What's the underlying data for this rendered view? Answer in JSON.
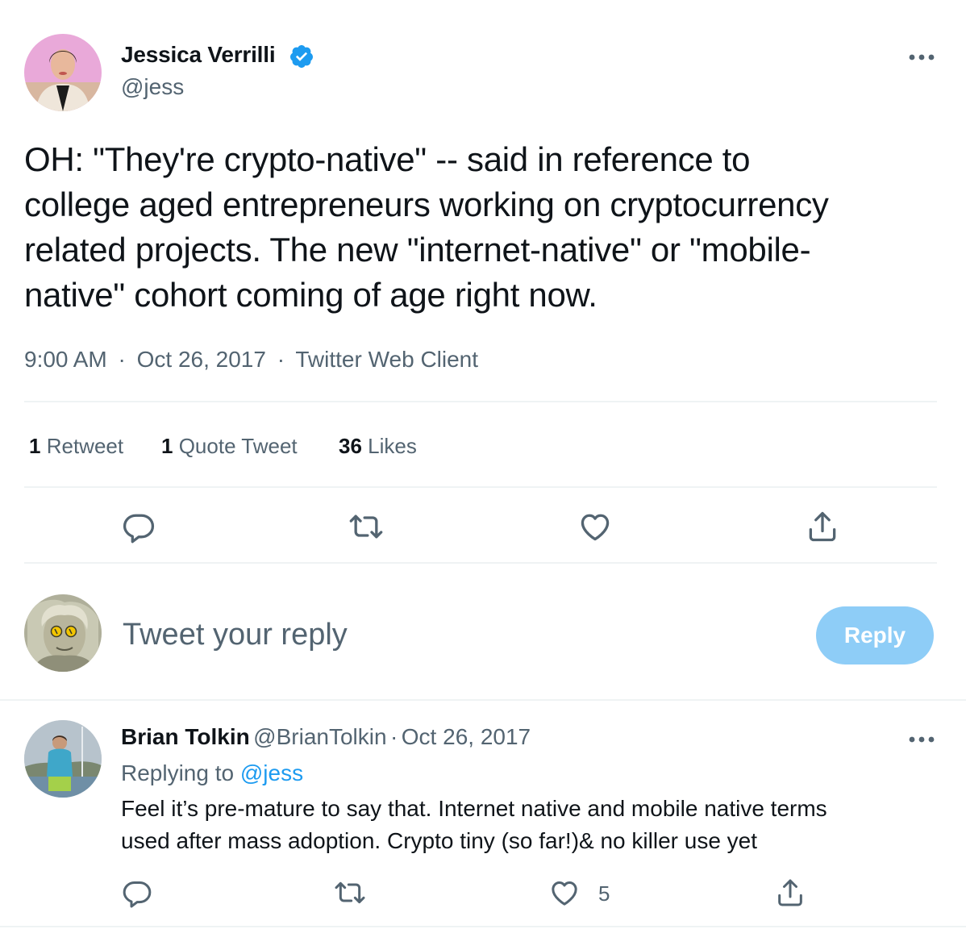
{
  "tweet": {
    "author_name": "Jessica Verrilli",
    "author_handle": "@jess",
    "text": "OH: \"They're crypto-native\" -- said in reference to\ncollege aged entrepreneurs working on cryptocurrency\nrelated projects. The new \"internet-native\" or \"mobile-\nnative\" cohort coming of age right now.",
    "time": "9:00 AM",
    "date": "Oct 26, 2017",
    "source": "Twitter Web Client",
    "separator": "·"
  },
  "stats": {
    "retweets_count": "1",
    "retweets_label": "Retweet",
    "quotes_count": "1",
    "quotes_label": "Quote Tweet",
    "likes_count": "36",
    "likes_label": "Likes"
  },
  "composer": {
    "placeholder": "Tweet your reply",
    "button_label": "Reply"
  },
  "reply": {
    "author_name": "Brian Tolkin",
    "author_handle": "@BrianTolkin",
    "separator": "·",
    "date": "Oct 26, 2017",
    "replying_prefix": "Replying to",
    "replying_to": "@jess",
    "text_line1": "Feel it’s pre-mature to say that. Internet native and mobile native terms",
    "text_line2": "used after mass adoption. Crypto tiny (so far!)& no killer use yet",
    "like_count": "5"
  },
  "icons": {
    "verified": "verified-badge-icon",
    "more": "more-options-icon",
    "reply": "reply-icon",
    "retweet": "retweet-icon",
    "like": "heart-icon",
    "share": "share-icon"
  },
  "colors": {
    "text": "#0f1419",
    "secondary": "#536471",
    "accent": "#1d9bf0",
    "reply_button_disabled": "#8ecdf7",
    "divider": "#eff3f4"
  }
}
